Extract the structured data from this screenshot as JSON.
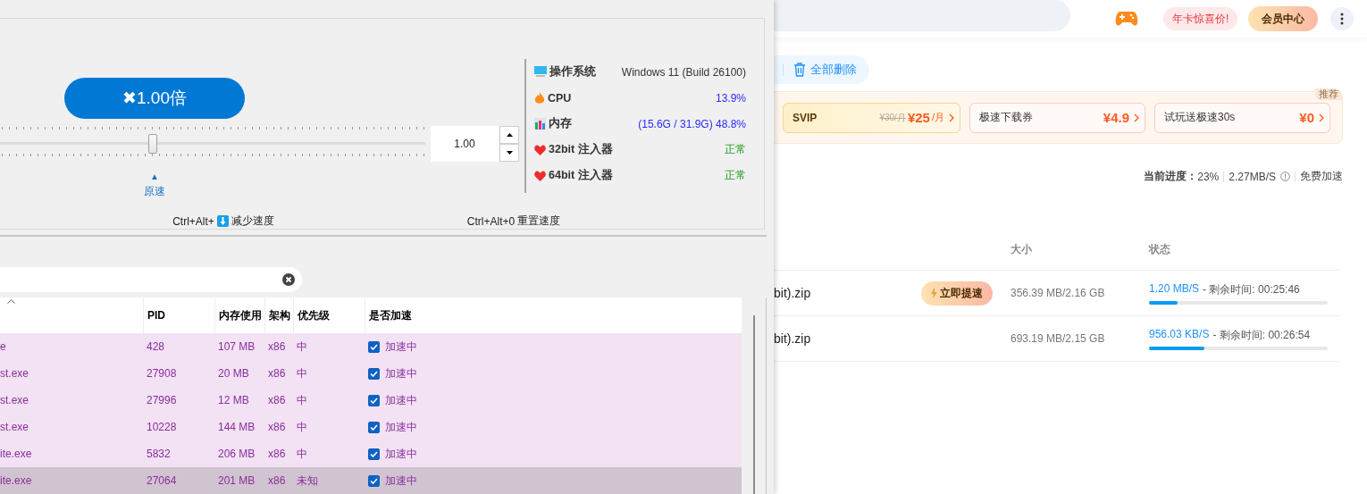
{
  "speed_panel": {
    "multiplier_button": "✖1.00倍",
    "slider": {
      "level": 0.36
    },
    "value_field": "1.00",
    "marker": {
      "arrow": "▲",
      "label": "原速"
    },
    "hotkeys": [
      {
        "keys": "Ctrl+Alt+",
        "arrow_icon": true,
        "action": "减少速度"
      },
      {
        "keys": "Ctrl+Alt+0",
        "action": "重置速度"
      }
    ]
  },
  "system_info": [
    {
      "kind": "os",
      "label": "操作系统",
      "value": "Windows 11 (Build 26100)"
    },
    {
      "kind": "cpu",
      "label": "CPU",
      "value": "13.9%"
    },
    {
      "kind": "memory",
      "label": "内存",
      "value": "(15.6G / 31.9G) 48.8%"
    },
    {
      "kind": "injector",
      "label": "32bit 注入器",
      "value": "正常"
    },
    {
      "kind": "injector",
      "label": "64bit 注入器",
      "value": "正常"
    }
  ],
  "process_table": {
    "columns": [
      "PID",
      "内存使用",
      "架构",
      "优先级",
      "是否加速"
    ],
    "rows": [
      {
        "name": "e",
        "pid": "428",
        "memory": "107 MB",
        "arch": "x86",
        "priority": "中",
        "accelerated": true,
        "status": "加速中",
        "selected": false
      },
      {
        "name": "st.exe",
        "pid": "27908",
        "memory": "20 MB",
        "arch": "x86",
        "priority": "中",
        "accelerated": true,
        "status": "加速中",
        "selected": false
      },
      {
        "name": "st.exe",
        "pid": "27996",
        "memory": "12 MB",
        "arch": "x86",
        "priority": "中",
        "accelerated": true,
        "status": "加速中",
        "selected": false
      },
      {
        "name": "st.exe",
        "pid": "10228",
        "memory": "144 MB",
        "arch": "x86",
        "priority": "中",
        "accelerated": true,
        "status": "加速中",
        "selected": false
      },
      {
        "name": "ite.exe",
        "pid": "5832",
        "memory": "206 MB",
        "arch": "x86",
        "priority": "中",
        "accelerated": true,
        "status": "加速中",
        "selected": false
      },
      {
        "name": "ite.exe",
        "pid": "27064",
        "memory": "201 MB",
        "arch": "x86",
        "priority": "未知",
        "accelerated": true,
        "status": "加速中",
        "selected": true
      }
    ]
  },
  "top_bar": {
    "promo": "年卡惊喜价!",
    "member_button": "会员中心"
  },
  "toolbar": {
    "delete_all": "全部删除"
  },
  "offers": {
    "tag": "推荐",
    "items": [
      {
        "kind": "svip",
        "name": "SVIP",
        "old_price": "¥30/月",
        "price": "¥25",
        "unit": "/月"
      },
      {
        "kind": "coupon",
        "name": "极速下载券",
        "price": "¥4.9"
      },
      {
        "kind": "coupon",
        "name": "试玩送极速30s",
        "price": "¥0"
      }
    ]
  },
  "progress": {
    "label": "当前进度：",
    "percent": "23%",
    "speed": "2.27MB/S",
    "boost": "免费加速"
  },
  "downloads": {
    "columns": [
      "大小",
      "状态"
    ],
    "rows": [
      {
        "name": "bit).zip",
        "boost_button": "立即提速",
        "size": "356.39 MB/2.16 GB",
        "speed": "1.20 MB/S",
        "remaining": "- 剩余时间: 00:25:46",
        "level": 0.16
      },
      {
        "name": "bit).zip",
        "size": "693.19 MB/2.15 GB",
        "speed": "956.03 KB/S",
        "remaining": "- 剩余时间: 00:26:54",
        "level": 0.31
      }
    ]
  }
}
